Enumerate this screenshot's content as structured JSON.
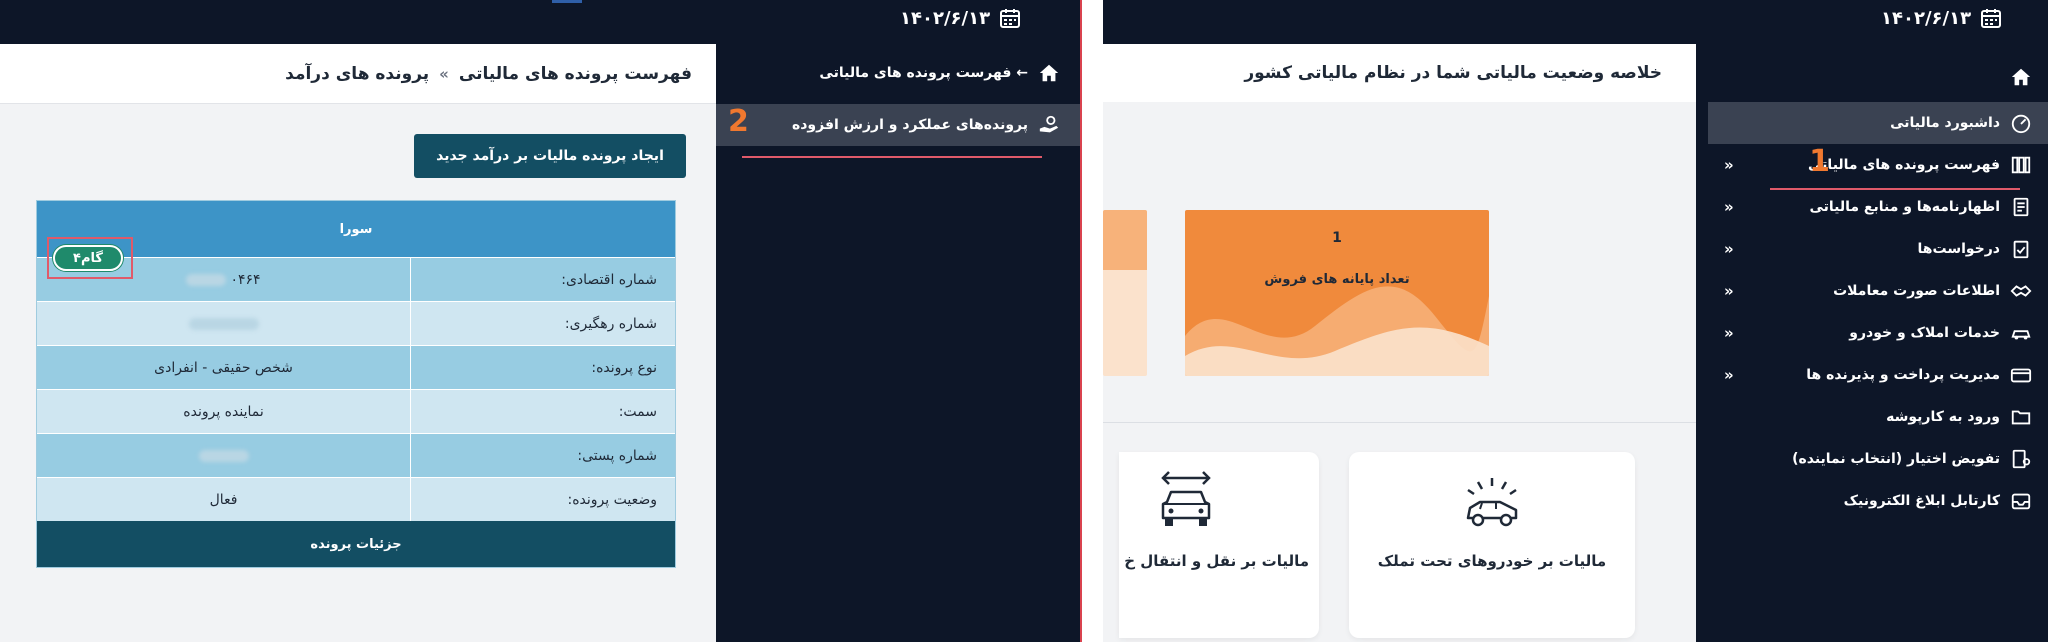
{
  "left_screen": {
    "date": "۱۴۰۲/۶/۱۳",
    "sidebar": {
      "header_link": "← فهرست پرونده های مالیاتی",
      "active_item": "پرونده‌های عملکرد و ارزش افزوده",
      "annotation_number": "2"
    },
    "breadcrumb": {
      "parent": "فهرست پرونده های مالیاتی",
      "separator": "»",
      "current": "پرونده های درآمد"
    },
    "create_button": "ایجاد پرونده مالیات بر درآمد جدید",
    "card": {
      "title": "سورا",
      "step_badge": "گام۴",
      "rows": [
        {
          "label": "شماره اقتصادی:",
          "value": "۰۴۶۴"
        },
        {
          "label": "شماره رهگیری:",
          "value": ""
        },
        {
          "label": "نوع پرونده:",
          "value": "شخص حقیقی - انفرادی"
        },
        {
          "label": "سمت:",
          "value": "نماینده پرونده"
        },
        {
          "label": "شماره پستی:",
          "value": ""
        },
        {
          "label": "وضعیت پرونده:",
          "value": "فعال"
        }
      ],
      "footer_button": "جزئیات پرونده"
    }
  },
  "right_screen": {
    "date": "۱۴۰۲/۶/۱۳",
    "summary_title": "خلاصه وضعیت مالیاتی شما در نظام مالیاتی کشور",
    "annotation_number": "1",
    "menu": [
      {
        "label": "داشبورد مالیاتی",
        "icon": "gauge-icon",
        "chevron": false,
        "active": true
      },
      {
        "label": "فهرست پرونده های مالیاتی",
        "icon": "files-icon",
        "chevron": true,
        "active": false
      },
      {
        "label": "اظهارنامه‌ها و منابع مالیاتی",
        "icon": "document-icon",
        "chevron": true,
        "active": false
      },
      {
        "label": "درخواست‌ها",
        "icon": "request-icon",
        "chevron": true,
        "active": false
      },
      {
        "label": "اطلاعات صورت معاملات",
        "icon": "handshake-icon",
        "chevron": true,
        "active": false
      },
      {
        "label": "خدمات املاک و خودرو",
        "icon": "car-icon",
        "chevron": true,
        "active": false
      },
      {
        "label": "مدیریت پرداخت و پذیرنده ها",
        "icon": "card-icon",
        "chevron": true,
        "active": false
      },
      {
        "label": "ورود به کارپوشه",
        "icon": "folder-icon",
        "chevron": false,
        "active": false
      },
      {
        "label": "تفویض اختیار (انتخاب نماینده)",
        "icon": "delegate-icon",
        "chevron": false,
        "active": false
      },
      {
        "label": "کارتابل ابلاغ الکترونیک",
        "icon": "inbox-icon",
        "chevron": false,
        "active": false
      }
    ],
    "stat_card": {
      "value": "1",
      "label": "تعداد پایانه های فروش"
    },
    "tiles": [
      {
        "label": "مالیات بر خودروهای تحت تملک",
        "icon": "car-alert-icon"
      },
      {
        "label": "مالیات بر نقل و انتقال خ",
        "icon": "car-transfer-icon"
      }
    ],
    "colors": {
      "sidebar_bg": "#0d1628",
      "content_bg": "#f2f3f5",
      "active_menu_bg": "#3a4252",
      "stat_card": "#f08a3c",
      "annotation": "#f0782f",
      "highlight_line": "#e05a6a",
      "card_header": "#3d94c7",
      "dark_teal": "#134e63",
      "badge_green": "#1f8a6b"
    }
  }
}
